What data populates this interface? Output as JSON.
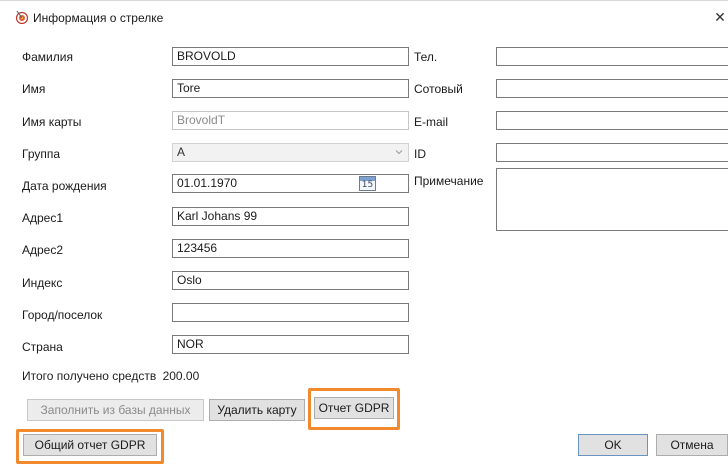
{
  "window": {
    "title": "Информация о стрелке",
    "close_symbol": "✕"
  },
  "icons": {
    "app": "archer-target-icon",
    "close": "close-icon",
    "calendar": "calendar-icon",
    "combo_arrow": "chevron-down-icon"
  },
  "form": {
    "last_name": {
      "label": "Фамилия",
      "value": "BROVOLD"
    },
    "first_name": {
      "label": "Имя",
      "value": "Tore"
    },
    "card_name": {
      "label": "Имя карты",
      "value": "BrovoldT"
    },
    "group": {
      "label": "Группа",
      "value": "A"
    },
    "birth_date": {
      "label": "Дата рождения",
      "value": "01.01.1970",
      "calendar_day": "15"
    },
    "address1": {
      "label": "Адрес1",
      "value": "Karl Johans 99"
    },
    "address2": {
      "label": "Адрес2",
      "value": "123456"
    },
    "postal": {
      "label": "Индекс",
      "value": "Oslo"
    },
    "city": {
      "label": "Город/поселок",
      "value": ""
    },
    "country": {
      "label": "Страна",
      "value": "NOR"
    },
    "phone": {
      "label": "Тел.",
      "value": ""
    },
    "mobile": {
      "label": "Сотовый",
      "value": ""
    },
    "email": {
      "label": "E-mail",
      "value": ""
    },
    "id": {
      "label": "ID",
      "value": ""
    },
    "note": {
      "label": "Примечание",
      "value": ""
    }
  },
  "total": {
    "label": "Итого получено средств",
    "value": "200.00"
  },
  "buttons": {
    "fill_from_db": "Заполнить из базы данных",
    "delete_card": "Удалить карту",
    "gdpr_report": "Отчет GDPR",
    "general_gdpr_report": "Общий отчет GDPR",
    "ok": "OK",
    "cancel": "Отмена"
  },
  "colors": {
    "highlight": "#f08a2c",
    "button_face": "#e1e1e1",
    "field_border": "#7a7a7a"
  }
}
